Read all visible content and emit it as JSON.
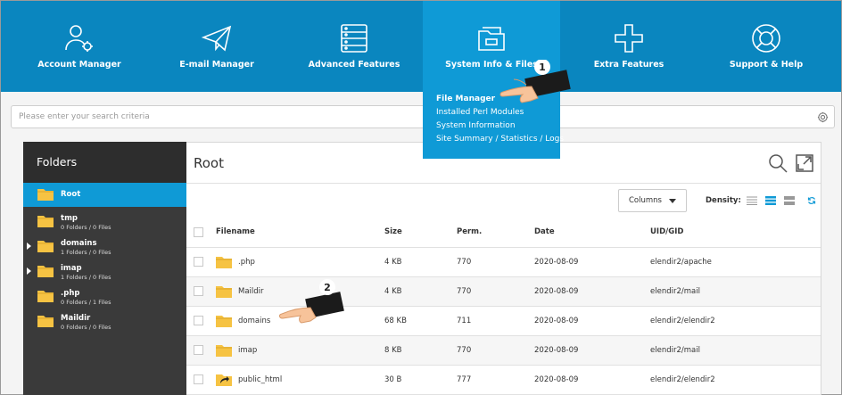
{
  "nav": {
    "items": [
      {
        "label": "Account Manager",
        "icon": "users-gear-icon"
      },
      {
        "label": "E-mail Manager",
        "icon": "paper-plane-icon"
      },
      {
        "label": "Advanced Features",
        "icon": "server-database-icon"
      },
      {
        "label": "System Info & Files",
        "icon": "file-cabinet-icon"
      },
      {
        "label": "Extra Features",
        "icon": "plus-icon"
      },
      {
        "label": "Support & Help",
        "icon": "lifebuoy-icon"
      }
    ]
  },
  "dropdown": {
    "items": [
      "File Manager",
      "Installed Perl Modules",
      "System Information",
      "Site Summary / Statistics / Logs"
    ]
  },
  "search": {
    "placeholder": "Please enter your search criteria"
  },
  "folders": {
    "title": "Folders",
    "items": [
      {
        "name": "Root",
        "sub": ""
      },
      {
        "name": "tmp",
        "sub": "0 Folders / 0 Files"
      },
      {
        "name": "domains",
        "sub": "1 Folders / 0 Files"
      },
      {
        "name": "imap",
        "sub": "1 Folders / 0 Files"
      },
      {
        "name": ".php",
        "sub": "0 Folders / 1 Files"
      },
      {
        "name": "Maildir",
        "sub": "0 Folders / 0 Files"
      }
    ]
  },
  "main": {
    "title": "Root",
    "columns_label": "Columns",
    "density_label": "Density:",
    "headers": {
      "filename": "Filename",
      "size": "Size",
      "perm": "Perm.",
      "date": "Date",
      "uid": "UID/GID"
    },
    "rows": [
      {
        "name": ".php",
        "size": "4 KB",
        "perm": "770",
        "date": "2020-08-09",
        "uid": "elendir2/apache"
      },
      {
        "name": "Maildir",
        "size": "4 KB",
        "perm": "770",
        "date": "2020-08-09",
        "uid": "elendir2/mail"
      },
      {
        "name": "domains",
        "size": "68 KB",
        "perm": "711",
        "date": "2020-08-09",
        "uid": "elendir2/elendir2"
      },
      {
        "name": "imap",
        "size": "8 KB",
        "perm": "770",
        "date": "2020-08-09",
        "uid": "elendir2/mail"
      },
      {
        "name": "public_html",
        "size": "30 B",
        "perm": "777",
        "date": "2020-08-09",
        "uid": "elendir2/elendir2"
      }
    ]
  },
  "markers": {
    "step1": "1",
    "step2": "2"
  },
  "colors": {
    "nav_bg": "#0a86bf",
    "accent": "#0f9ad6",
    "folder": "#f6c343"
  }
}
